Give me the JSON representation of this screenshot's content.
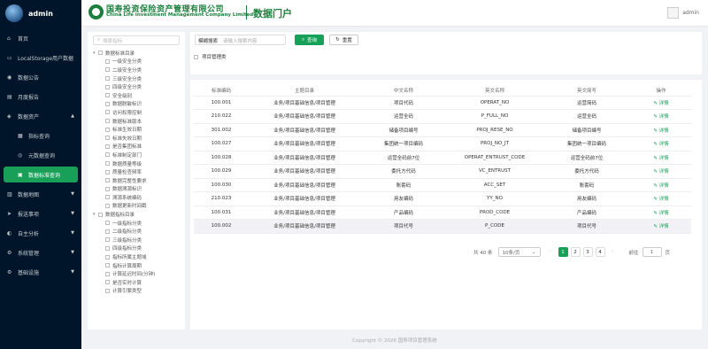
{
  "app": {
    "user_name": "admin"
  },
  "header": {
    "company_cn": "国寿投资保险资产管理有限公司",
    "company_en": "China Life Investment Management Company Limited",
    "portal_title": "数据门户",
    "user_label": "admin"
  },
  "sidebar": {
    "items": [
      {
        "label": "首页",
        "icon": "home-icon"
      },
      {
        "label": "LocalStorage用户数据",
        "icon": "file-icon"
      },
      {
        "label": "数据公告",
        "icon": "notice-icon"
      },
      {
        "label": "月度报告",
        "icon": "report-icon"
      },
      {
        "label": "数据资产",
        "icon": "asset-icon"
      },
      {
        "label": "指标查询",
        "icon": "index-icon"
      },
      {
        "label": "元数据查询",
        "icon": "meta-icon"
      },
      {
        "label": "数据标准查询",
        "icon": "standard-icon"
      },
      {
        "label": "数据地图",
        "icon": "map-icon"
      },
      {
        "label": "报送事项",
        "icon": "submit-icon"
      },
      {
        "label": "自主分析",
        "icon": "analysis-icon"
      },
      {
        "label": "系统管理",
        "icon": "system-icon"
      },
      {
        "label": "基础设施",
        "icon": "infra-icon"
      }
    ]
  },
  "tree": {
    "search_placeholder": "搜索指标",
    "nodes": [
      "数据标准目录",
      "一级安全分类",
      "二级安全分类",
      "三级安全分类",
      "四级安全分类",
      "安全级别",
      "数据脱敏标识",
      "访问权限控制",
      "数据标准版本",
      "标准生效日期",
      "标准失效日期",
      "是否集团标准",
      "标准制定部门",
      "数据质量等级",
      "质量检查频率",
      "数据完整性要求",
      "数据溯源标识",
      "溯源系统编码",
      "数据更新时间戳",
      "数据指标目录",
      "一级指标分类",
      "二级指标分类",
      "三级指标分类",
      "四级指标分类",
      "指标所属主题域",
      "指标计算周期",
      "计算延迟时间(分钟)",
      "是否实时计算",
      "计算引擎类型"
    ]
  },
  "search": {
    "label": "模糊搜索",
    "placeholder": "请输入搜索内容",
    "query_label": "查询",
    "reset_label": "重置",
    "filter_label": "项目管理类"
  },
  "table": {
    "headers": [
      "标准编码",
      "主题目录",
      "中文名称",
      "英文名称",
      "英文简写",
      "操作"
    ],
    "action_label": "详情",
    "rows": [
      [
        "100.001",
        "业务/项目基础信息/项目管理",
        "项目代码",
        "OPERAT_NO",
        "运营简码"
      ],
      [
        "210.022",
        "业务/项目基础信息/项目管理",
        "运营全码",
        "P_FULL_NO",
        "运营全码"
      ],
      [
        "301.002",
        "业务/项目基础信息/项目管理",
        "储备项目编号",
        "PROJ_RESE_NO",
        "储备项目编号"
      ],
      [
        "100.027",
        "业务/项目基础信息/项目管理",
        "集团统一项目编码",
        "PROJ_NO_JT",
        "集团统一项目编码"
      ],
      [
        "100.028",
        "业务/项目基础信息/项目管理",
        "运营全码前7位",
        "OPERAT_ENTRUST_CODE",
        "运营全码前7位"
      ],
      [
        "100.029",
        "业务/项目基础信息/项目管理",
        "委托方代码",
        "VC_ENTRUST",
        "委托方代码"
      ],
      [
        "100.030",
        "业务/项目基础信息/项目管理",
        "账套码",
        "ACC_SET",
        "账套码"
      ],
      [
        "210.023",
        "业务/项目基础信息/项目管理",
        "用友编码",
        "YY_NO",
        "用友编码"
      ],
      [
        "100.031",
        "业务/项目基础信息/项目管理",
        "产品编码",
        "PROD_CODE",
        "产品编码"
      ],
      [
        "100.002",
        "业务/项目基础信息/项目管理",
        "项目代号",
        "P_CODE",
        "项目代号"
      ]
    ]
  },
  "pagination": {
    "total": "共 40 条",
    "page_size": "10条/页",
    "pages": [
      "1",
      "2",
      "3",
      "4"
    ],
    "current": "1",
    "goto_label": "前往",
    "goto_value": "1",
    "page_unit": "页"
  },
  "footer": {
    "text": "Copyright © 2026 国寿项目管理系统"
  }
}
